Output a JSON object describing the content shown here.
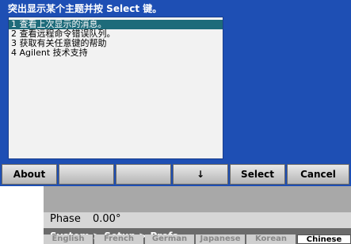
{
  "background": {
    "phase_label": "Phase",
    "phase_value": "0.00°",
    "breadcrumb": "System > Setup > Prefs",
    "languages": [
      "English",
      "French",
      "German",
      "Japanese",
      "Korean",
      "Chinese"
    ],
    "selected_language": "Chinese"
  },
  "dialog": {
    "title": "突出显示某个主题并按 Select 键。",
    "items": [
      "1 查看上次显示的消息。",
      "2 查看远程命令错误队列。",
      "3 获取有关任意键的帮助",
      "4 Agilent 技术支持"
    ],
    "selected_index": 0
  },
  "softkeys": {
    "about": "About",
    "down": "↓",
    "select": "Select",
    "cancel": "Cancel"
  },
  "colors": {
    "dialog_blue": "#1e4fb4",
    "selected_row": "#1e6b7a"
  }
}
